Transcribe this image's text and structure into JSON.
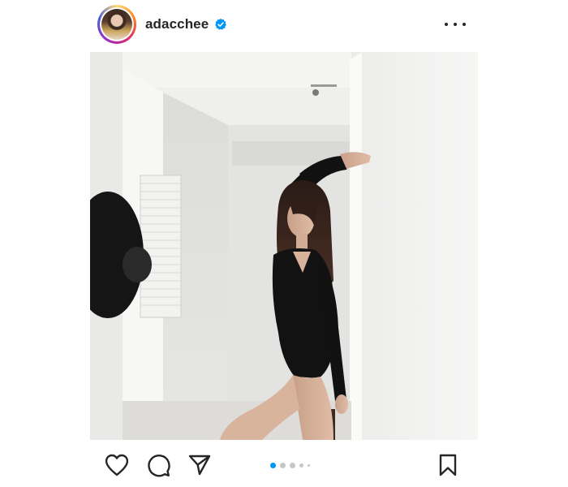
{
  "post": {
    "username": "adacchee",
    "verified": true,
    "image_description_icon": "photo",
    "carousel": {
      "total": 5,
      "active_index": 0
    }
  },
  "icons": {
    "verified": "verified-badge-icon",
    "more": "more-options-icon",
    "like": "heart-icon",
    "comment": "comment-icon",
    "share": "paper-plane-icon",
    "save": "bookmark-icon"
  },
  "colors": {
    "accent": "#0095f6",
    "text": "#262626",
    "inactive_dot": "#c7c7c7"
  }
}
